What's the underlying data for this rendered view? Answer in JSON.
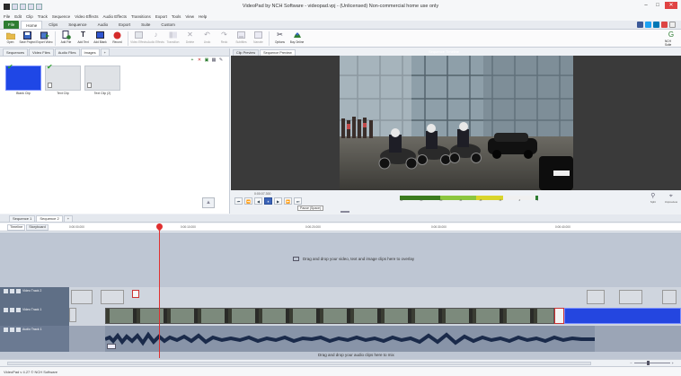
{
  "window": {
    "title": "VideoPad by NCH Software - videopad.vpj - (Unlicensed) Non-commercial home use only"
  },
  "menu": [
    "File",
    "Edit",
    "Clip",
    "Track",
    "Sequence",
    "Video Effects",
    "Audio Effects",
    "Transitions",
    "Export",
    "Tools",
    "View",
    "Help"
  ],
  "ribbon_tabs": [
    "File",
    "Home",
    "Clips",
    "Sequence",
    "Audio",
    "Export",
    "Suite",
    "Custom"
  ],
  "ribbon_buttons": [
    {
      "label": "Open",
      "icon": "folder-icon"
    },
    {
      "label": "Save Project",
      "icon": "save-icon"
    },
    {
      "label": "Export Video",
      "icon": "export-video-icon"
    },
    {
      "label": "Add File",
      "icon": "add-file-icon"
    },
    {
      "label": "Add Text",
      "icon": "add-text-icon"
    },
    {
      "label": "Add Blank",
      "icon": "add-blank-icon"
    },
    {
      "label": "Record",
      "icon": "record-icon"
    },
    {
      "label": "Video Effects",
      "icon": "video-effects-icon"
    },
    {
      "label": "Audio Effects",
      "icon": "audio-effects-icon"
    },
    {
      "label": "Transition",
      "icon": "transition-icon"
    },
    {
      "label": "Delete",
      "icon": "delete-icon"
    },
    {
      "label": "Undo",
      "icon": "undo-icon"
    },
    {
      "label": "Redo",
      "icon": "redo-icon"
    },
    {
      "label": "Subtitles",
      "icon": "subtitles-icon"
    },
    {
      "label": "Narrate",
      "icon": "narrate-icon"
    },
    {
      "label": "Options",
      "icon": "options-icon"
    },
    {
      "label": "Buy Online",
      "icon": "buy-online-icon"
    }
  ],
  "nch_suite_label": "NCH Suite",
  "bin": {
    "tabs": [
      "Sequences",
      "Video Files",
      "Audio Files",
      "Images",
      "+"
    ],
    "clips": [
      {
        "name": "Blank Clip",
        "style": "blue"
      },
      {
        "name": "Text Clip",
        "style": "grey"
      },
      {
        "name": "Text Clip (2)",
        "style": "grey"
      }
    ]
  },
  "preview": {
    "tabs": [
      "Clip Preview",
      "Sequence Preview"
    ],
    "sequence_title": "Sequence Timeline",
    "timecode": "0:00:07.300",
    "transport": [
      "⏮",
      "⏪",
      "◀",
      "⏸",
      "▶",
      "⏩",
      "⏭"
    ],
    "tooltip": "Pause (Space)",
    "meter_ticks": [
      "-42",
      "-36",
      "-30",
      "-24",
      "-18",
      "-12",
      "-6",
      "0"
    ],
    "right_buttons": [
      {
        "label": "Split",
        "icon": "split-icon"
      },
      {
        "label": "Unpreview",
        "icon": "unpreview-icon"
      }
    ]
  },
  "sequences": [
    "Sequence 1",
    "Sequence 2",
    "+"
  ],
  "timeline": {
    "modes": [
      "Timeline",
      "Storyboard"
    ],
    "ruler": [
      "0:00:00.000",
      "0:00:10.000",
      "0:00:20.000",
      "0:00:30.000",
      "0:00:40.000"
    ],
    "overlay_message": "Drag and drop your video, text and image clips here to overlay",
    "audio_message": "Drag and drop your audio clips here to mix",
    "tracks": {
      "video2": "Video Track 2",
      "video1": "Video Track 1",
      "audio1": "Audio Track 1"
    }
  },
  "status": "VideoPad v 4.27 © NCH Software",
  "colors": {
    "accent_green": "#2e7d32",
    "blank_clip_blue": "#1f47e6",
    "playhead_red": "#e03030",
    "track_header": "#5f6f86"
  }
}
